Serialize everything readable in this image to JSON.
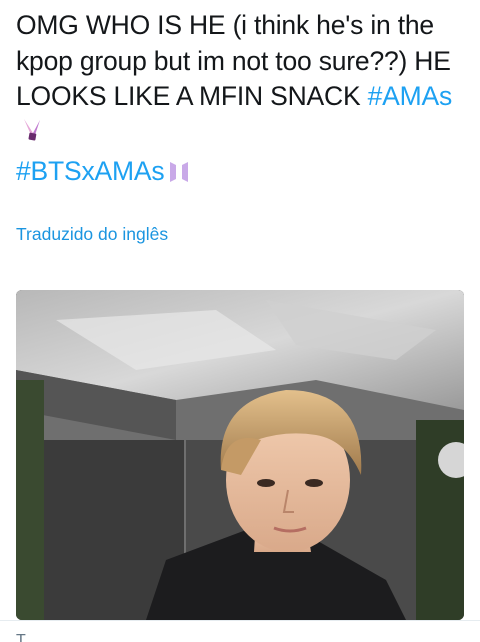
{
  "tweet": {
    "text_part1": "OMG WHO IS HE (i think he's in the kpop group but im not too sure??) HE LOOKS LIKE A MFIN SNACK ",
    "hashtag_1": "#AMAs",
    "hashtag_2": "#BTSxAMAs",
    "translated_label": "Traduzido do inglês",
    "cutoff_text": "T . . . ."
  },
  "colors": {
    "text": "#14171a",
    "link": "#1da1f2",
    "translate_link": "#1b95e0"
  },
  "icons": {
    "emoji_1": "ribbon-award-icon",
    "emoji_2": "bts-logo-icon"
  }
}
